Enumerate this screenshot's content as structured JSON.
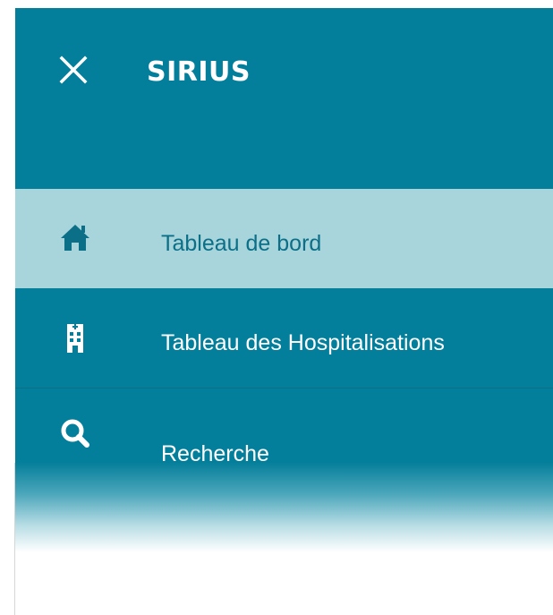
{
  "app": {
    "title": "SIRIUS"
  },
  "header": {
    "close_icon": "close-icon"
  },
  "nav": {
    "items": [
      {
        "label": "Tableau de bord",
        "icon": "home-icon",
        "active": true
      },
      {
        "label": "Tableau des Hospitalisations",
        "icon": "hospital-icon",
        "active": false
      },
      {
        "label": "Recherche",
        "icon": "search-icon",
        "active": false
      }
    ]
  },
  "colors": {
    "panel": "#037f9c",
    "active_bg": "#a8d4dc",
    "active_text": "#0b6f87",
    "text": "#ffffff"
  }
}
